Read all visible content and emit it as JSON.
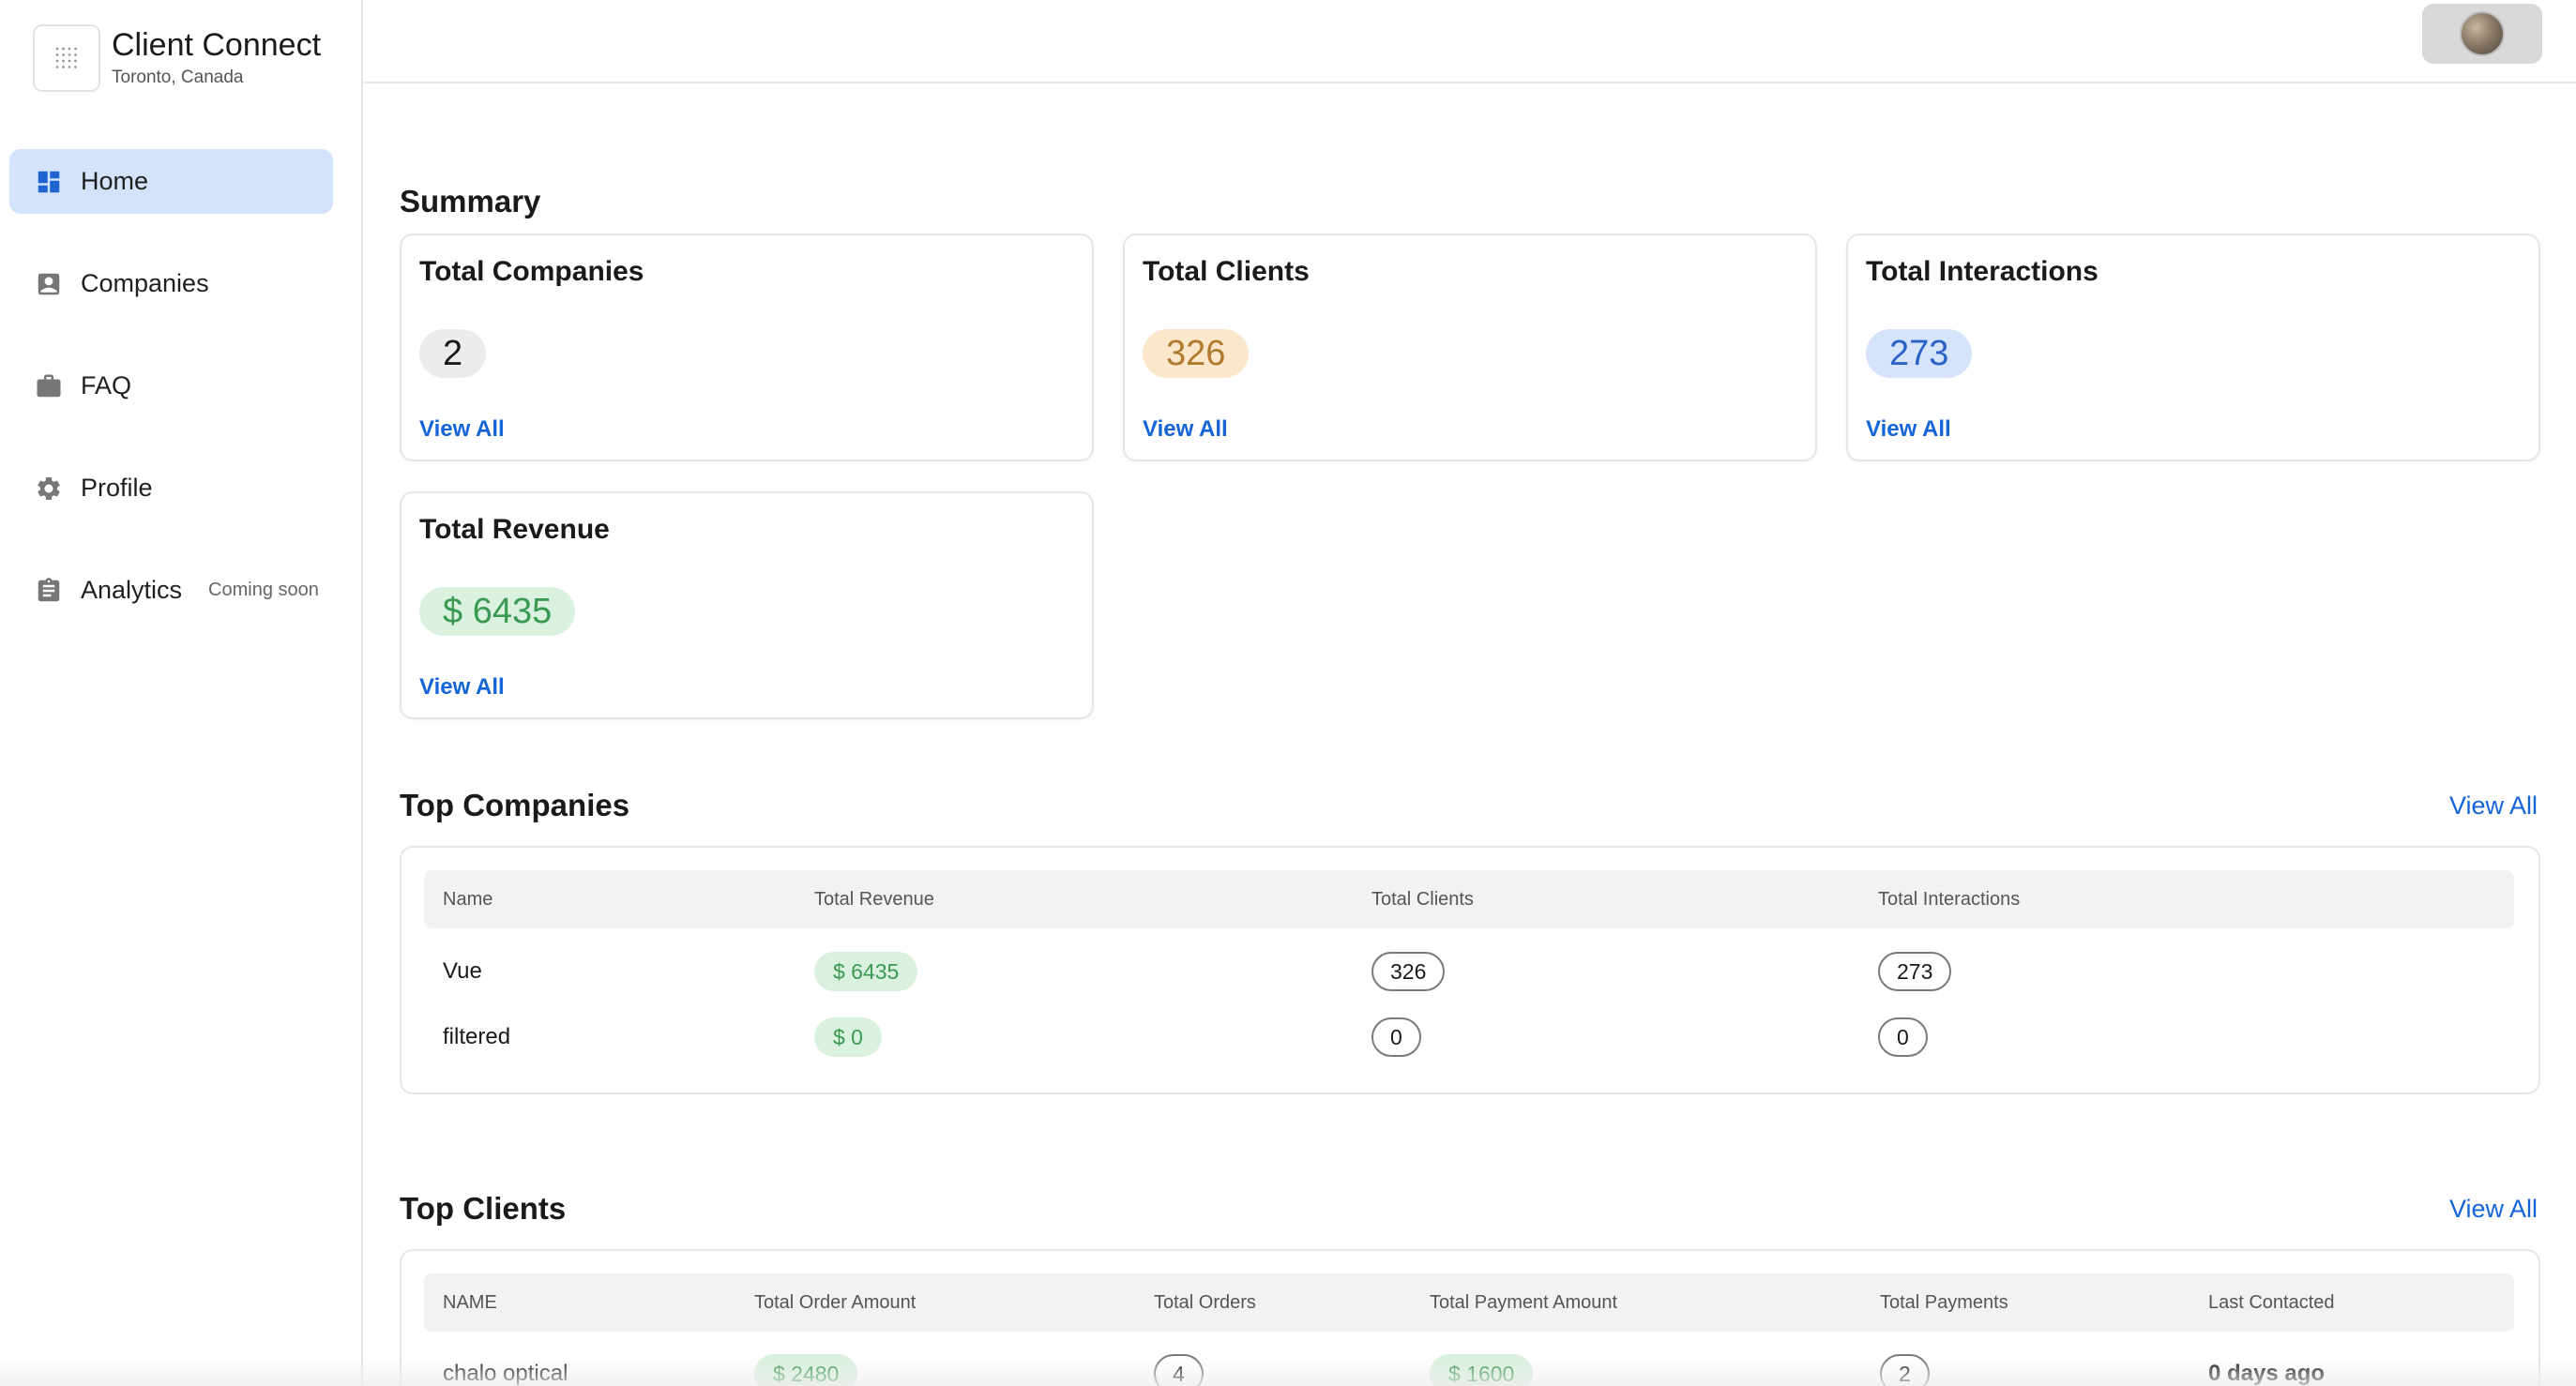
{
  "brand": {
    "title": "Client Connect",
    "location": "Toronto, Canada"
  },
  "sidebar": {
    "items": [
      {
        "label": "Home",
        "icon": "dashboard-icon",
        "active": true
      },
      {
        "label": "Companies",
        "icon": "contact-card-icon"
      },
      {
        "label": "FAQ",
        "icon": "briefcase-icon"
      },
      {
        "label": "Profile",
        "icon": "gear-icon"
      },
      {
        "label": "Analytics",
        "icon": "clipboard-icon",
        "badge": "Coming soon"
      }
    ]
  },
  "summary": {
    "title": "Summary",
    "cards": [
      {
        "title": "Total Companies",
        "value": "2",
        "link": "View All"
      },
      {
        "title": "Total Clients",
        "value": "326",
        "link": "View All"
      },
      {
        "title": "Total Interactions",
        "value": "273",
        "link": "View All"
      },
      {
        "title": "Total Revenue",
        "value": "$ 6435",
        "link": "View All"
      }
    ]
  },
  "top_companies": {
    "title": "Top Companies",
    "view_all": "View All",
    "columns": [
      "Name",
      "Total Revenue",
      "Total Clients",
      "Total Interactions"
    ],
    "rows": [
      {
        "name": "Vue",
        "revenue": "$ 6435",
        "clients": "326",
        "interactions": "273"
      },
      {
        "name": "filtered",
        "revenue": "$ 0",
        "clients": "0",
        "interactions": "0"
      }
    ]
  },
  "top_clients": {
    "title": "Top Clients",
    "view_all": "View All",
    "columns": [
      "NAME",
      "Total Order Amount",
      "Total Orders",
      "Total Payment Amount",
      "Total Payments",
      "Last Contacted"
    ],
    "rows": [
      {
        "name": "chalo optical",
        "order_amount": "$ 2480",
        "orders": "4",
        "payment_amount": "$ 1600",
        "payments": "2",
        "last_contacted": "0 days ago"
      }
    ]
  },
  "colors": {
    "accent": "#1565d8",
    "active_nav": "#d3e3fb",
    "green_pill": "#d9f1de",
    "orange_pill": "#fbe8cc",
    "blue_pill": "#d6e4fb"
  }
}
